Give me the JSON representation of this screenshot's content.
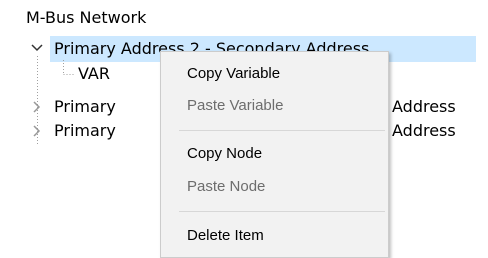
{
  "tree": {
    "root_label": "M-Bus Network",
    "nodes": [
      {
        "label": "Primary Address 2 - Secondary Address",
        "expanded": true,
        "selected": true
      },
      {
        "label": "VAR",
        "child": true
      },
      {
        "label": "Primary",
        "tail": "Address",
        "expanded": false
      },
      {
        "label": "Primary",
        "tail": "Address",
        "expanded": false
      }
    ]
  },
  "context_menu": {
    "items": [
      {
        "label": "Copy Variable",
        "enabled": true
      },
      {
        "label": "Paste Variable",
        "enabled": false
      },
      {
        "label": "Copy Node",
        "enabled": true
      },
      {
        "label": "Paste Node",
        "enabled": false
      },
      {
        "label": "Delete Item",
        "enabled": true
      }
    ]
  },
  "colors": {
    "selection": "#cce8ff",
    "menu_background": "#f2f2f2",
    "disabled_text": "#6d6d6d"
  }
}
